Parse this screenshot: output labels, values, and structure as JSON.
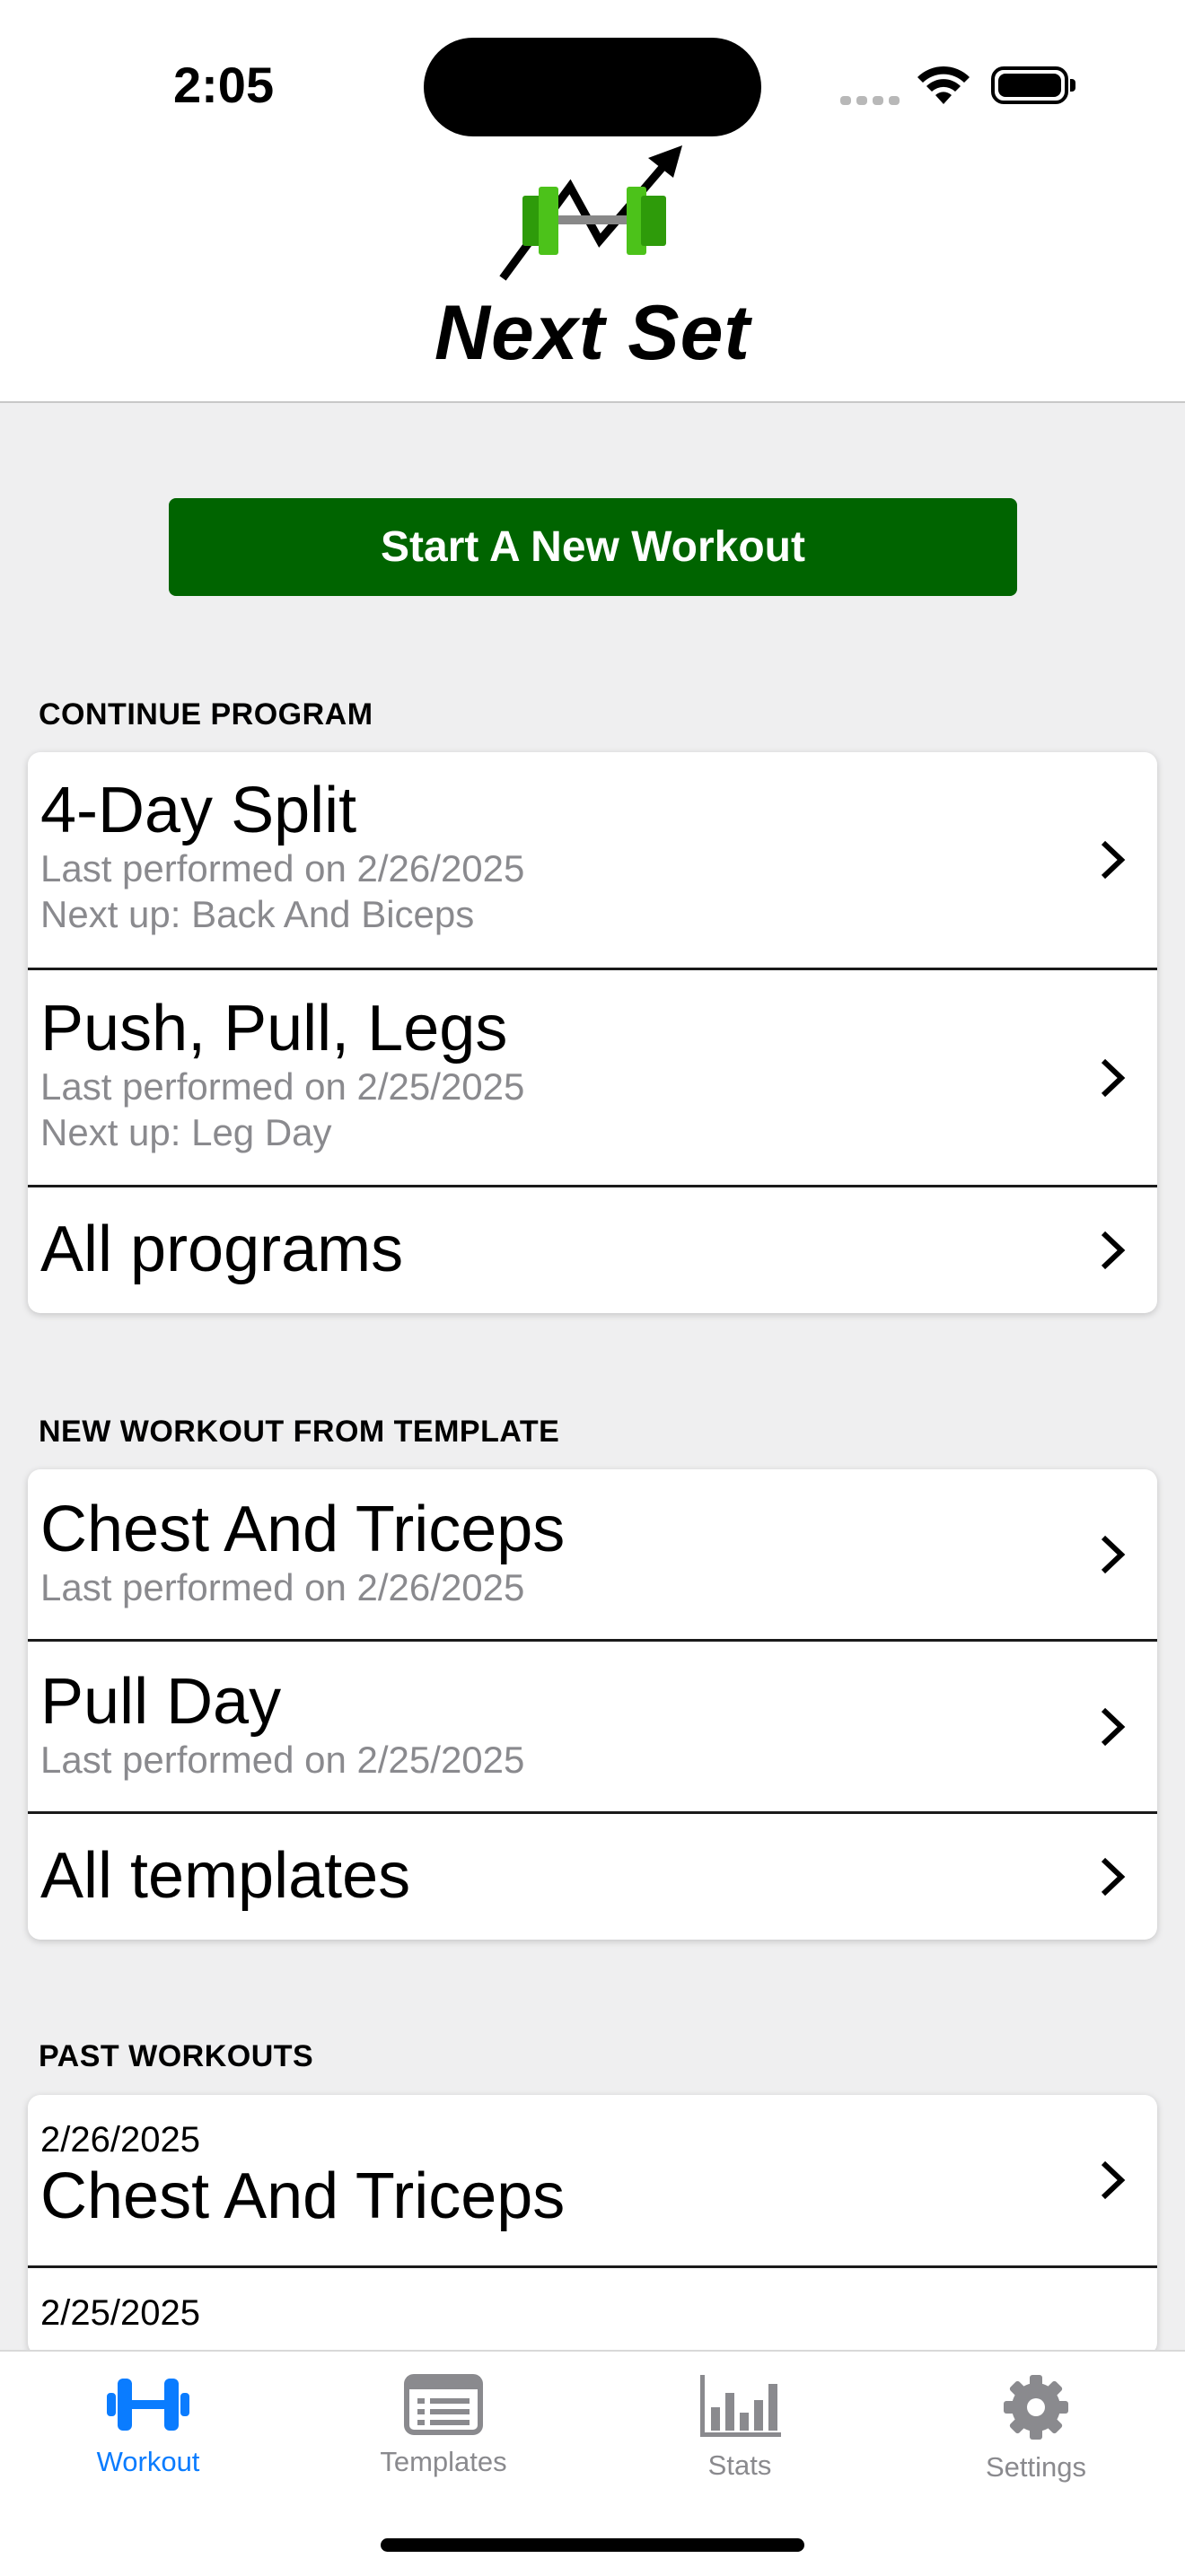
{
  "status": {
    "time": "2:05"
  },
  "app": {
    "title": "Next Set"
  },
  "start_button": "Start A New Workout",
  "continue_program": {
    "label": "CONTINUE PROGRAM",
    "items": [
      {
        "title": "4-Day Split",
        "last": "Last performed on 2/26/2025",
        "next": "Next up: Back And Biceps"
      },
      {
        "title": "Push, Pull, Legs",
        "last": "Last performed on 2/25/2025",
        "next": "Next up: Leg Day"
      }
    ],
    "all": "All programs"
  },
  "templates": {
    "label": "NEW WORKOUT FROM TEMPLATE",
    "items": [
      {
        "title": "Chest And Triceps",
        "last": "Last performed on 2/26/2025"
      },
      {
        "title": "Pull Day",
        "last": "Last performed on 2/25/2025"
      }
    ],
    "all": "All templates"
  },
  "past": {
    "label": "PAST WORKOUTS",
    "items": [
      {
        "date": "2/26/2025",
        "title": "Chest And Triceps"
      },
      {
        "date": "2/25/2025"
      }
    ]
  },
  "tabs": [
    {
      "label": "Workout",
      "icon": "dumbbell-icon",
      "active": true
    },
    {
      "label": "Templates",
      "icon": "list-icon",
      "active": false
    },
    {
      "label": "Stats",
      "icon": "bar-chart-icon",
      "active": false
    },
    {
      "label": "Settings",
      "icon": "gear-icon",
      "active": false
    }
  ],
  "colors": {
    "accent_green": "#006400",
    "tab_active": "#0a7cff",
    "tab_inactive": "#8a8a8e"
  }
}
